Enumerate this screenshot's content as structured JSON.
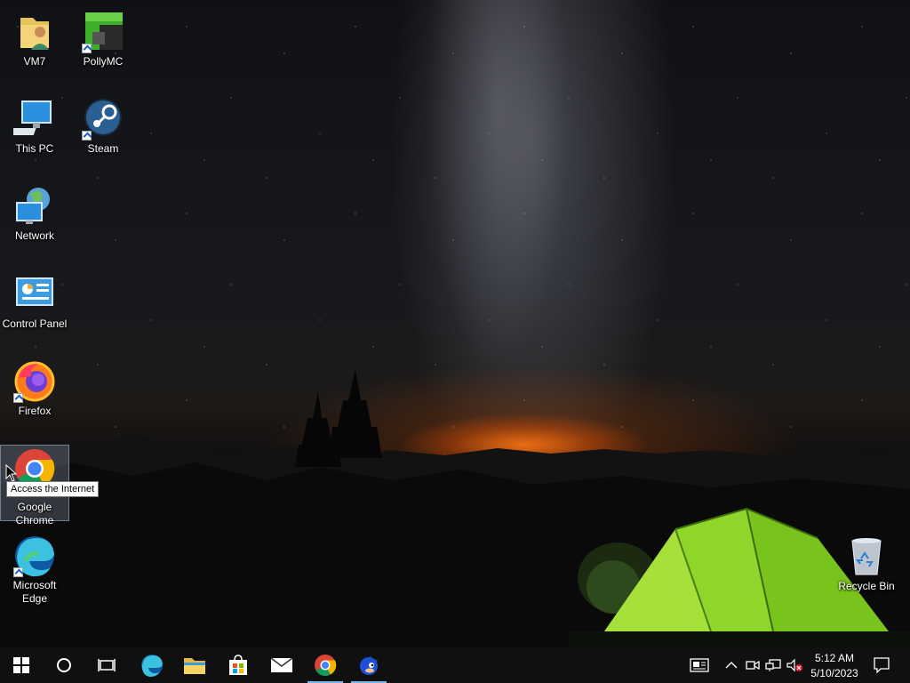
{
  "desktop": {
    "icons": [
      {
        "label": "VM7"
      },
      {
        "label": "PollyMC"
      },
      {
        "label": "This PC"
      },
      {
        "label": "Steam"
      },
      {
        "label": "Network"
      },
      {
        "label": "Control Panel"
      },
      {
        "label": "Firefox"
      },
      {
        "label": "Google Chrome"
      },
      {
        "label": "Microsoft Edge"
      },
      {
        "label": "Recycle Bin"
      }
    ],
    "tooltip": "Access the Internet"
  },
  "taskbar": {
    "clock_time": "5:12 AM",
    "clock_date": "5/10/2023",
    "accent_color": "#76b9ed"
  }
}
